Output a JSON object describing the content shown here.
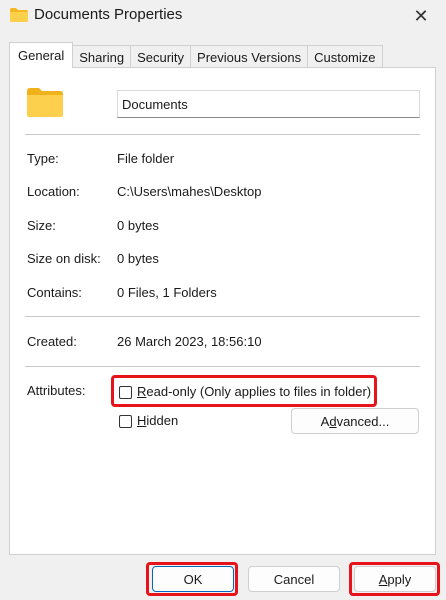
{
  "window": {
    "title": "Documents Properties",
    "title_icon": "folder-icon",
    "close_glyph": "✕"
  },
  "tabs": [
    {
      "label": "General",
      "active": true
    },
    {
      "label": "Sharing",
      "active": false
    },
    {
      "label": "Security",
      "active": false
    },
    {
      "label": "Previous Versions",
      "active": false
    },
    {
      "label": "Customize",
      "active": false
    }
  ],
  "general": {
    "folder_icon": "folder-icon",
    "name_value": "Documents",
    "type_label": "Type:",
    "type_value": "File folder",
    "location_label": "Location:",
    "location_value": "C:\\Users\\mahes\\Desktop",
    "size_label": "Size:",
    "size_value": "0 bytes",
    "size_on_disk_label": "Size on disk:",
    "size_on_disk_value": "0 bytes",
    "contains_label": "Contains:",
    "contains_value": "0 Files, 1 Folders",
    "created_label": "Created:",
    "created_value": "26 March 2023, 18:56:10",
    "attributes_label": "Attributes:",
    "readonly_rest": "ead-only (Only applies to files in folder)",
    "readonly_accel": "R",
    "hidden_accel": "H",
    "hidden_rest": "idden",
    "advanced_pre": "A",
    "advanced_accel": "d",
    "advanced_rest": "vanced...",
    "readonly_checked": false,
    "hidden_checked": false
  },
  "buttons": {
    "ok": "OK",
    "cancel": "Cancel",
    "apply_accel": "A",
    "apply_rest": "pply"
  },
  "colors": {
    "highlight": "#e8121b",
    "folder_yellow": "#f8c838",
    "primary_border": "#0067c0"
  }
}
